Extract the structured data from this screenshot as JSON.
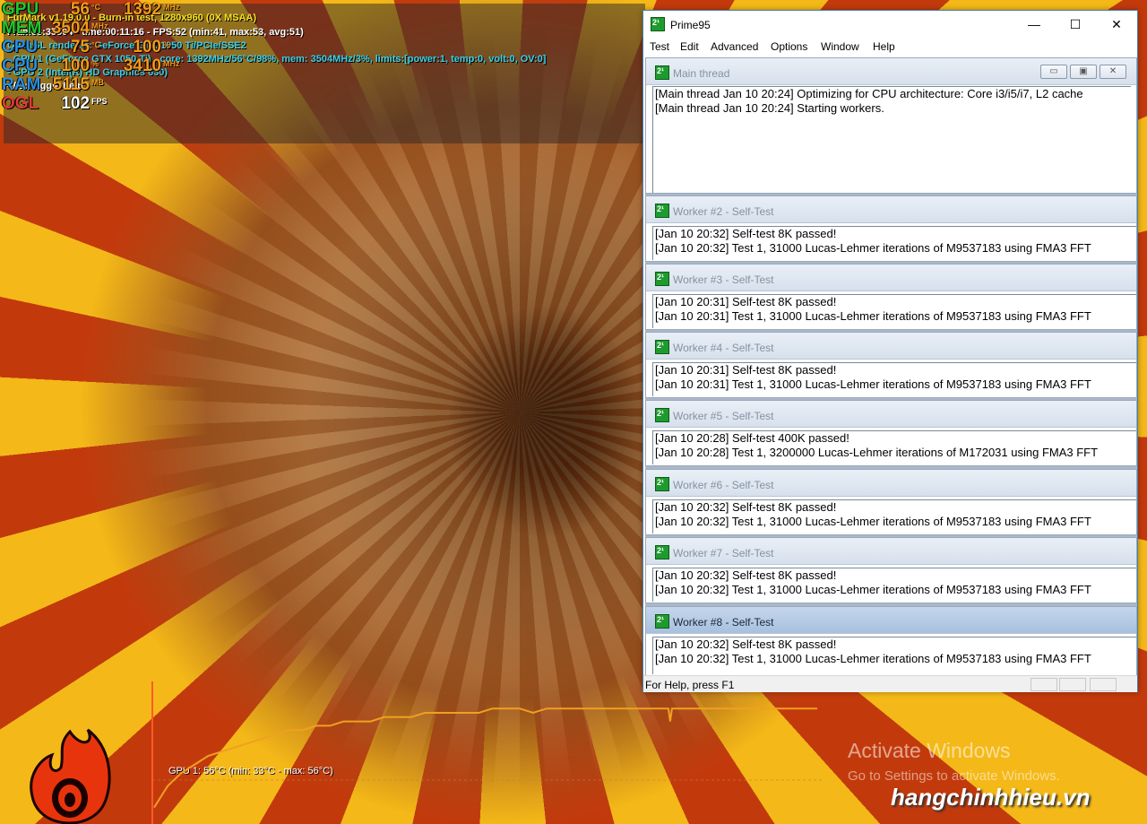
{
  "osd": {
    "rows": [
      {
        "label": "GPU",
        "label_color": "#20c830",
        "value": "56",
        "unit": "°C",
        "value2": "1392",
        "unit2": "MHz"
      },
      {
        "label": "MEM",
        "label_color": "#20c830",
        "value": "3504",
        "unit": "MHz"
      },
      {
        "label": "CPU",
        "label_color": "#2a8fe0",
        "value": "75",
        "unit": "°C",
        "value2": "100",
        "unit2": "%"
      },
      {
        "label": "CPU",
        "label_color": "#2a8fe0",
        "value": "100",
        "unit": "%",
        "value2": "3410",
        "unit2": "MHz"
      },
      {
        "label": "RAM",
        "label_color": "#2a8fe0",
        "value": "5115",
        "unit": "MB"
      },
      {
        "label": "OGL",
        "label_color": "#e03a3a",
        "value": "102",
        "unit": "FPS"
      }
    ],
    "lines": [
      {
        "text": "FurMark v1.19.0.0 - Burn-in test, 1280x960 (0X MSAA)",
        "color": "#f7e020"
      },
      {
        "text": "Frames:35504 - time:00:11:16 - FPS:52 (min:41, max:53, avg:51)",
        "color": "#ffffff"
      },
      {
        "text": "OpenGL renderer: GeForce GTX 1050 Ti/PCIe/SSE2",
        "color": "#3ad0e8"
      },
      {
        "text": "- GPU 1 (GeForce GTX 1050 Ti) - core: 1392MHz/56°C/98%, mem: 3504MHz/3%, limits:[power:1, temp:0, volt:0, OV:0]",
        "color": "#3ad0e8"
      },
      {
        "text": "- GPU 2 (Intel(R) HD Graphics 630)",
        "color": "#3ad0e8"
      },
      {
        "text": "- F1: toggle help",
        "color": "#ffffff"
      }
    ]
  },
  "graph": {
    "title": "GPU 1: 56°C (min: 33°C - max: 56°C)",
    "line_color": "#f0a020",
    "temps": [
      33,
      38,
      41,
      43,
      45,
      46,
      47,
      48,
      49,
      50,
      51,
      51,
      52,
      52,
      53,
      53,
      53,
      54,
      54,
      54,
      55,
      55,
      55,
      55,
      55,
      56,
      56,
      56,
      55,
      56,
      56,
      56,
      56,
      56,
      56,
      56,
      56,
      56,
      56,
      56,
      56,
      56,
      56,
      56,
      56,
      56,
      56,
      56,
      56,
      56
    ],
    "dip_index": 38,
    "dip_value": 53
  },
  "watermark": {
    "activate_title": "Activate Windows",
    "activate_sub": "Go to Settings to activate Windows.",
    "brand": "hangchinhhieu.vn"
  },
  "prime95": {
    "title": "Prime95",
    "window_controls": [
      "—",
      "☐",
      "✕"
    ],
    "menu": [
      "Test",
      "Edit",
      "Advanced",
      "Options",
      "Window",
      "Help"
    ],
    "main_thread": {
      "title": "Main thread",
      "lines": [
        "[Main thread Jan 10 20:24] Optimizing for CPU architecture: Core i3/i5/i7, L2 cache",
        "[Main thread Jan 10 20:24] Starting workers."
      ]
    },
    "workers": [
      {
        "title": "Worker #2 - Self-Test",
        "lines": [
          "[Jan 10 20:32] Self-test 8K passed!",
          "[Jan 10 20:32] Test 1, 31000 Lucas-Lehmer iterations of M9537183 using FMA3 FFT"
        ]
      },
      {
        "title": "Worker #3 - Self-Test",
        "lines": [
          "[Jan 10 20:31] Self-test 8K passed!",
          "[Jan 10 20:31] Test 1, 31000 Lucas-Lehmer iterations of M9537183 using FMA3 FFT"
        ]
      },
      {
        "title": "Worker #4 - Self-Test",
        "lines": [
          "[Jan 10 20:31] Self-test 8K passed!",
          "[Jan 10 20:31] Test 1, 31000 Lucas-Lehmer iterations of M9537183 using FMA3 FFT"
        ]
      },
      {
        "title": "Worker #5 - Self-Test",
        "lines": [
          "[Jan 10 20:28] Self-test 400K passed!",
          "[Jan 10 20:28] Test 1, 3200000 Lucas-Lehmer iterations of M172031 using FMA3 FFT"
        ]
      },
      {
        "title": "Worker #6 - Self-Test",
        "lines": [
          "[Jan 10 20:32] Self-test 8K passed!",
          "[Jan 10 20:32] Test 1, 31000 Lucas-Lehmer iterations of M9537183 using FMA3 FFT"
        ]
      },
      {
        "title": "Worker #7 - Self-Test",
        "lines": [
          "[Jan 10 20:32] Self-test 8K passed!",
          "[Jan 10 20:32] Test 1, 31000 Lucas-Lehmer iterations of M9537183 using FMA3 FFT"
        ]
      },
      {
        "title": "Worker #8 - Self-Test",
        "lines": [
          "[Jan 10 20:32] Self-test 8K passed!",
          "[Jan 10 20:32] Test 1, 31000 Lucas-Lehmer iterations of M9537183 using FMA3 FFT"
        ]
      }
    ],
    "status": "For Help, press F1"
  }
}
